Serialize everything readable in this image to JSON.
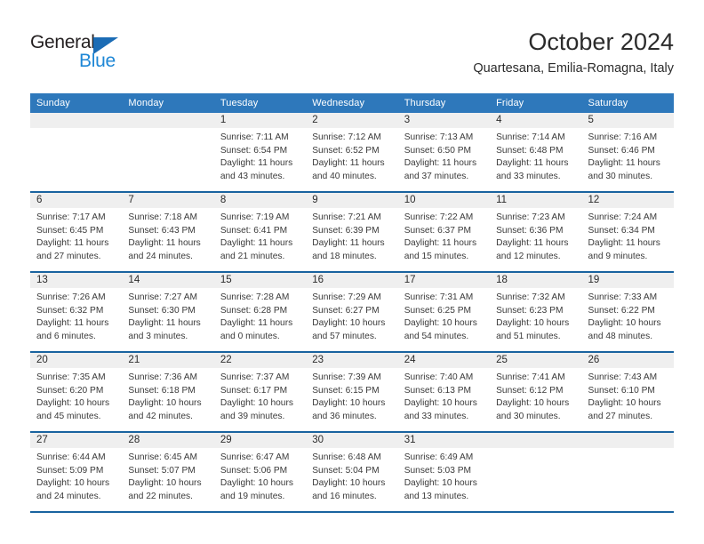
{
  "brand": {
    "name_dark": "General",
    "name_blue": "Blue",
    "accent_blue": "#1e87d6",
    "logo_triangle_color": "#1b6cb5"
  },
  "header": {
    "title": "October 2024",
    "subtitle": "Quartesana, Emilia-Romagna, Italy"
  },
  "theme": {
    "header_bg": "#2e78bb",
    "row_divider": "#19639f",
    "daynum_bg": "#efefef",
    "text": "#3a3a3a"
  },
  "weekday_headers": [
    "Sunday",
    "Monday",
    "Tuesday",
    "Wednesday",
    "Thursday",
    "Friday",
    "Saturday"
  ],
  "weeks": [
    [
      {
        "day": "",
        "empty": true,
        "sunrise": "",
        "sunset": "",
        "daylight1": "",
        "daylight2": ""
      },
      {
        "day": "",
        "empty": true,
        "sunrise": "",
        "sunset": "",
        "daylight1": "",
        "daylight2": ""
      },
      {
        "day": "1",
        "sunrise": "Sunrise: 7:11 AM",
        "sunset": "Sunset: 6:54 PM",
        "daylight1": "Daylight: 11 hours",
        "daylight2": "and 43 minutes."
      },
      {
        "day": "2",
        "sunrise": "Sunrise: 7:12 AM",
        "sunset": "Sunset: 6:52 PM",
        "daylight1": "Daylight: 11 hours",
        "daylight2": "and 40 minutes."
      },
      {
        "day": "3",
        "sunrise": "Sunrise: 7:13 AM",
        "sunset": "Sunset: 6:50 PM",
        "daylight1": "Daylight: 11 hours",
        "daylight2": "and 37 minutes."
      },
      {
        "day": "4",
        "sunrise": "Sunrise: 7:14 AM",
        "sunset": "Sunset: 6:48 PM",
        "daylight1": "Daylight: 11 hours",
        "daylight2": "and 33 minutes."
      },
      {
        "day": "5",
        "sunrise": "Sunrise: 7:16 AM",
        "sunset": "Sunset: 6:46 PM",
        "daylight1": "Daylight: 11 hours",
        "daylight2": "and 30 minutes."
      }
    ],
    [
      {
        "day": "6",
        "sunrise": "Sunrise: 7:17 AM",
        "sunset": "Sunset: 6:45 PM",
        "daylight1": "Daylight: 11 hours",
        "daylight2": "and 27 minutes."
      },
      {
        "day": "7",
        "sunrise": "Sunrise: 7:18 AM",
        "sunset": "Sunset: 6:43 PM",
        "daylight1": "Daylight: 11 hours",
        "daylight2": "and 24 minutes."
      },
      {
        "day": "8",
        "sunrise": "Sunrise: 7:19 AM",
        "sunset": "Sunset: 6:41 PM",
        "daylight1": "Daylight: 11 hours",
        "daylight2": "and 21 minutes."
      },
      {
        "day": "9",
        "sunrise": "Sunrise: 7:21 AM",
        "sunset": "Sunset: 6:39 PM",
        "daylight1": "Daylight: 11 hours",
        "daylight2": "and 18 minutes."
      },
      {
        "day": "10",
        "sunrise": "Sunrise: 7:22 AM",
        "sunset": "Sunset: 6:37 PM",
        "daylight1": "Daylight: 11 hours",
        "daylight2": "and 15 minutes."
      },
      {
        "day": "11",
        "sunrise": "Sunrise: 7:23 AM",
        "sunset": "Sunset: 6:36 PM",
        "daylight1": "Daylight: 11 hours",
        "daylight2": "and 12 minutes."
      },
      {
        "day": "12",
        "sunrise": "Sunrise: 7:24 AM",
        "sunset": "Sunset: 6:34 PM",
        "daylight1": "Daylight: 11 hours",
        "daylight2": "and 9 minutes."
      }
    ],
    [
      {
        "day": "13",
        "sunrise": "Sunrise: 7:26 AM",
        "sunset": "Sunset: 6:32 PM",
        "daylight1": "Daylight: 11 hours",
        "daylight2": "and 6 minutes."
      },
      {
        "day": "14",
        "sunrise": "Sunrise: 7:27 AM",
        "sunset": "Sunset: 6:30 PM",
        "daylight1": "Daylight: 11 hours",
        "daylight2": "and 3 minutes."
      },
      {
        "day": "15",
        "sunrise": "Sunrise: 7:28 AM",
        "sunset": "Sunset: 6:28 PM",
        "daylight1": "Daylight: 11 hours",
        "daylight2": "and 0 minutes."
      },
      {
        "day": "16",
        "sunrise": "Sunrise: 7:29 AM",
        "sunset": "Sunset: 6:27 PM",
        "daylight1": "Daylight: 10 hours",
        "daylight2": "and 57 minutes."
      },
      {
        "day": "17",
        "sunrise": "Sunrise: 7:31 AM",
        "sunset": "Sunset: 6:25 PM",
        "daylight1": "Daylight: 10 hours",
        "daylight2": "and 54 minutes."
      },
      {
        "day": "18",
        "sunrise": "Sunrise: 7:32 AM",
        "sunset": "Sunset: 6:23 PM",
        "daylight1": "Daylight: 10 hours",
        "daylight2": "and 51 minutes."
      },
      {
        "day": "19",
        "sunrise": "Sunrise: 7:33 AM",
        "sunset": "Sunset: 6:22 PM",
        "daylight1": "Daylight: 10 hours",
        "daylight2": "and 48 minutes."
      }
    ],
    [
      {
        "day": "20",
        "sunrise": "Sunrise: 7:35 AM",
        "sunset": "Sunset: 6:20 PM",
        "daylight1": "Daylight: 10 hours",
        "daylight2": "and 45 minutes."
      },
      {
        "day": "21",
        "sunrise": "Sunrise: 7:36 AM",
        "sunset": "Sunset: 6:18 PM",
        "daylight1": "Daylight: 10 hours",
        "daylight2": "and 42 minutes."
      },
      {
        "day": "22",
        "sunrise": "Sunrise: 7:37 AM",
        "sunset": "Sunset: 6:17 PM",
        "daylight1": "Daylight: 10 hours",
        "daylight2": "and 39 minutes."
      },
      {
        "day": "23",
        "sunrise": "Sunrise: 7:39 AM",
        "sunset": "Sunset: 6:15 PM",
        "daylight1": "Daylight: 10 hours",
        "daylight2": "and 36 minutes."
      },
      {
        "day": "24",
        "sunrise": "Sunrise: 7:40 AM",
        "sunset": "Sunset: 6:13 PM",
        "daylight1": "Daylight: 10 hours",
        "daylight2": "and 33 minutes."
      },
      {
        "day": "25",
        "sunrise": "Sunrise: 7:41 AM",
        "sunset": "Sunset: 6:12 PM",
        "daylight1": "Daylight: 10 hours",
        "daylight2": "and 30 minutes."
      },
      {
        "day": "26",
        "sunrise": "Sunrise: 7:43 AM",
        "sunset": "Sunset: 6:10 PM",
        "daylight1": "Daylight: 10 hours",
        "daylight2": "and 27 minutes."
      }
    ],
    [
      {
        "day": "27",
        "sunrise": "Sunrise: 6:44 AM",
        "sunset": "Sunset: 5:09 PM",
        "daylight1": "Daylight: 10 hours",
        "daylight2": "and 24 minutes."
      },
      {
        "day": "28",
        "sunrise": "Sunrise: 6:45 AM",
        "sunset": "Sunset: 5:07 PM",
        "daylight1": "Daylight: 10 hours",
        "daylight2": "and 22 minutes."
      },
      {
        "day": "29",
        "sunrise": "Sunrise: 6:47 AM",
        "sunset": "Sunset: 5:06 PM",
        "daylight1": "Daylight: 10 hours",
        "daylight2": "and 19 minutes."
      },
      {
        "day": "30",
        "sunrise": "Sunrise: 6:48 AM",
        "sunset": "Sunset: 5:04 PM",
        "daylight1": "Daylight: 10 hours",
        "daylight2": "and 16 minutes."
      },
      {
        "day": "31",
        "sunrise": "Sunrise: 6:49 AM",
        "sunset": "Sunset: 5:03 PM",
        "daylight1": "Daylight: 10 hours",
        "daylight2": "and 13 minutes."
      },
      {
        "day": "",
        "empty": true,
        "sunrise": "",
        "sunset": "",
        "daylight1": "",
        "daylight2": ""
      },
      {
        "day": "",
        "empty": true,
        "sunrise": "",
        "sunset": "",
        "daylight1": "",
        "daylight2": ""
      }
    ]
  ]
}
